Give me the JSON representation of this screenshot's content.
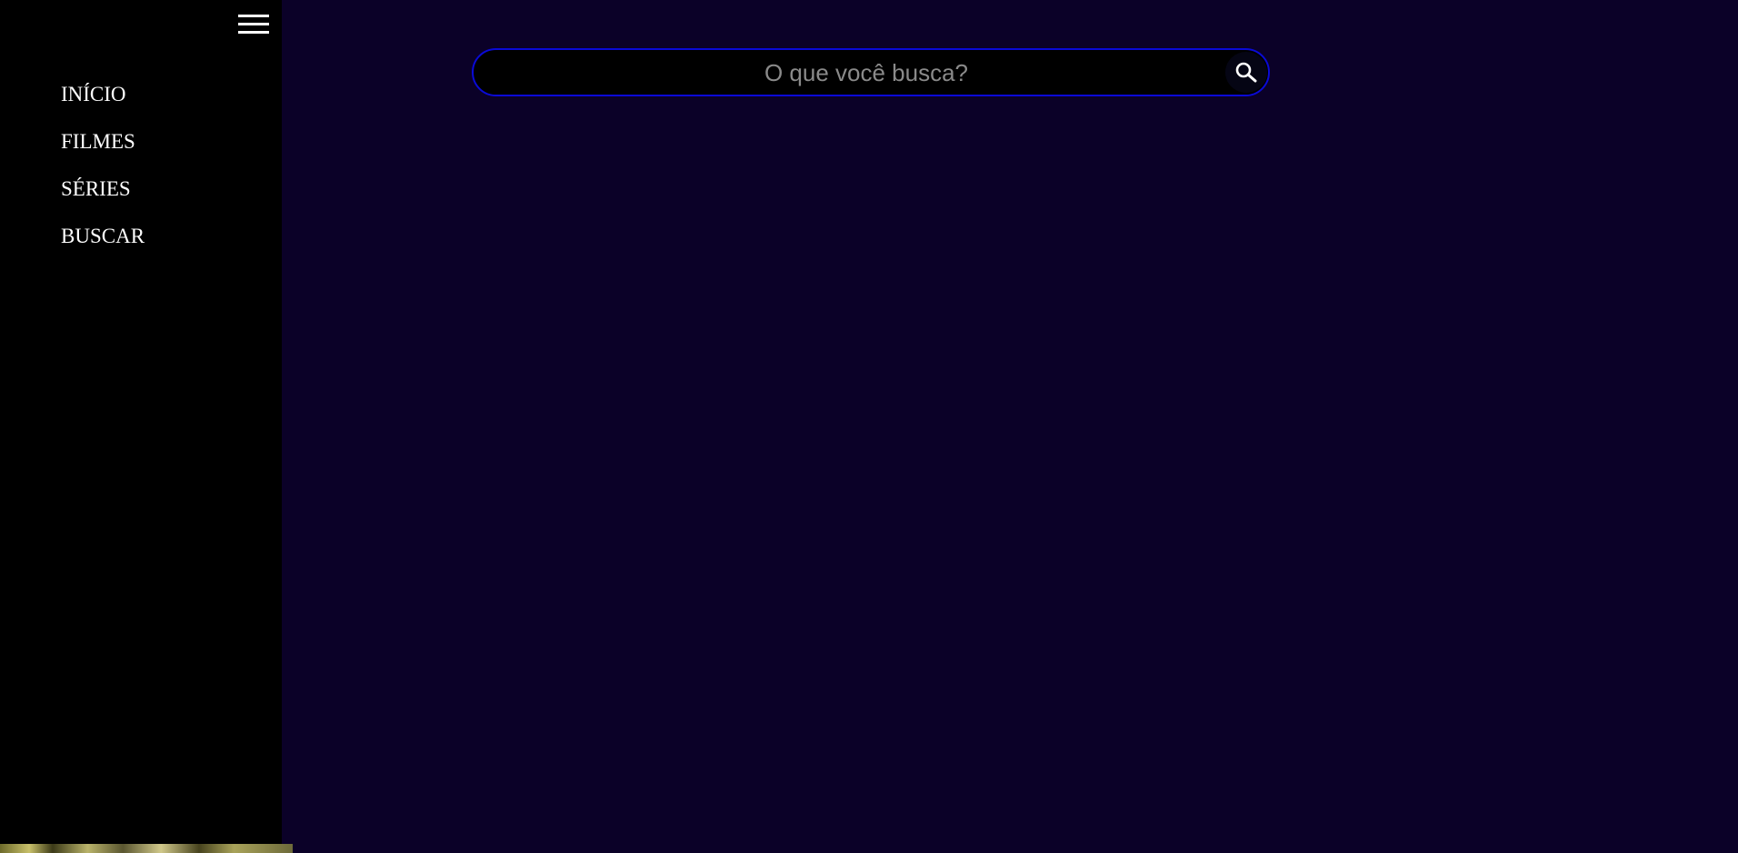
{
  "sidebar": {
    "menu_icon": "hamburger-menu-icon",
    "items": [
      {
        "label": "INÍCIO"
      },
      {
        "label": "FILMES"
      },
      {
        "label": "SÉRIES"
      },
      {
        "label": "BUSCAR"
      }
    ]
  },
  "search": {
    "placeholder": "O que você busca?",
    "value": "",
    "button_icon": "search-icon"
  },
  "colors": {
    "page_background": "#0b0128",
    "sidebar_background": "#000000",
    "search_border": "#0a0ad6",
    "nav_text": "#ffffff",
    "placeholder_text": "#8a8a8a"
  }
}
